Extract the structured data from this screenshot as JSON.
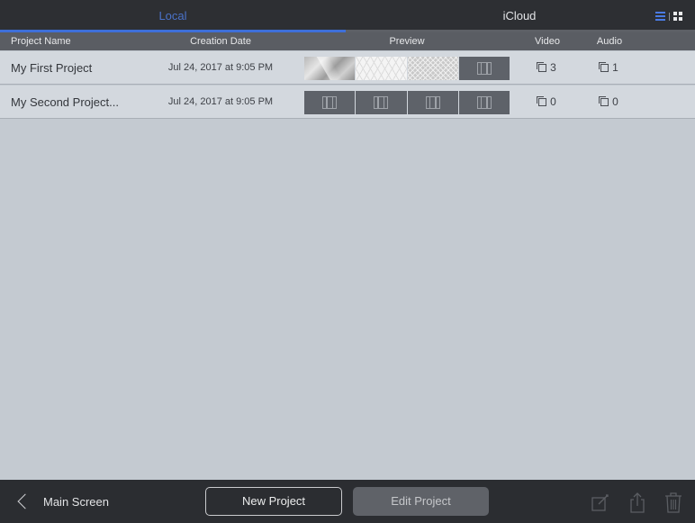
{
  "tabs": {
    "local": "Local",
    "icloud": "iCloud"
  },
  "columns": {
    "name": "Project Name",
    "date": "Creation Date",
    "preview": "Preview",
    "video": "Video",
    "audio": "Audio"
  },
  "projects": [
    {
      "name": "My First Project",
      "date": "Jul 24, 2017 at 9:05 PM",
      "preview_thumbs": [
        "polygon-image",
        "hexagon-image",
        "diamond-image",
        "film-placeholder"
      ],
      "video_count": "3",
      "audio_count": "1"
    },
    {
      "name": "My Second Project...",
      "date": "Jul 24, 2017 at 9:05 PM",
      "preview_thumbs": [
        "film-placeholder",
        "film-placeholder",
        "film-placeholder",
        "film-placeholder"
      ],
      "video_count": "0",
      "audio_count": "0"
    }
  ],
  "footer": {
    "back_label": "Main Screen",
    "new_project": "New Project",
    "edit_project": "Edit Project"
  },
  "icons": {
    "view_toggle": [
      "list-view-icon",
      "grid-view-icon"
    ],
    "footer": [
      "compose-icon",
      "share-icon",
      "trash-icon"
    ]
  },
  "colors": {
    "accent": "#3e6fd9",
    "background": "#c4cad1",
    "bar": "#2d2f33"
  }
}
